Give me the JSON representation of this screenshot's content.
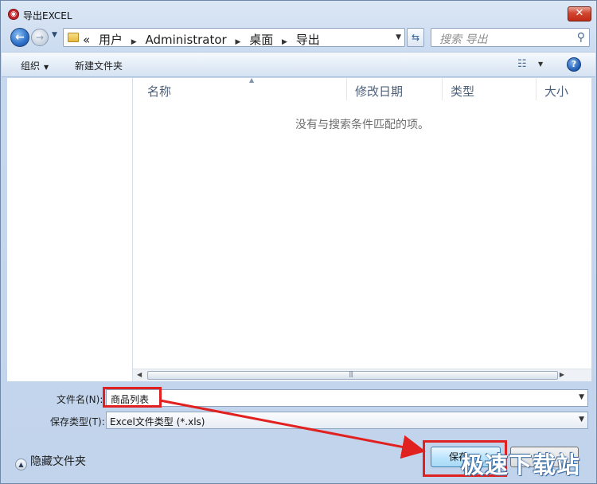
{
  "window": {
    "title": "导出EXCEL",
    "close_glyph": "✕"
  },
  "address": {
    "history_glyph": "«",
    "crumbs": [
      "用户",
      "Administrator",
      "桌面",
      "导出"
    ]
  },
  "search": {
    "placeholder": "搜索 导出"
  },
  "toolbar": {
    "organize_label": "组织",
    "new_folder_label": "新建文件夹"
  },
  "columns": {
    "name": "名称",
    "date": "修改日期",
    "type": "类型",
    "size": "大小"
  },
  "file_list": {
    "empty_message": "没有与搜索条件匹配的项。"
  },
  "form": {
    "filename_label": "文件名(N):",
    "filename_value": "商品列表",
    "type_label": "保存类型(T):",
    "type_value": "Excel文件类型 (*.xls)"
  },
  "footer": {
    "hide_folders_label": "隐藏文件夹",
    "save_label": "保存"
  },
  "watermark": "极速下载站",
  "colors": {
    "annotation_red": "#e1211f",
    "window_chrome": "#c7d8ee",
    "save_button_blue": "#bee6fd"
  },
  "icons": [
    "back-arrow-icon",
    "forward-arrow-icon",
    "folder-icon",
    "refresh-icon",
    "search-icon",
    "view-options-icon",
    "help-icon"
  ]
}
